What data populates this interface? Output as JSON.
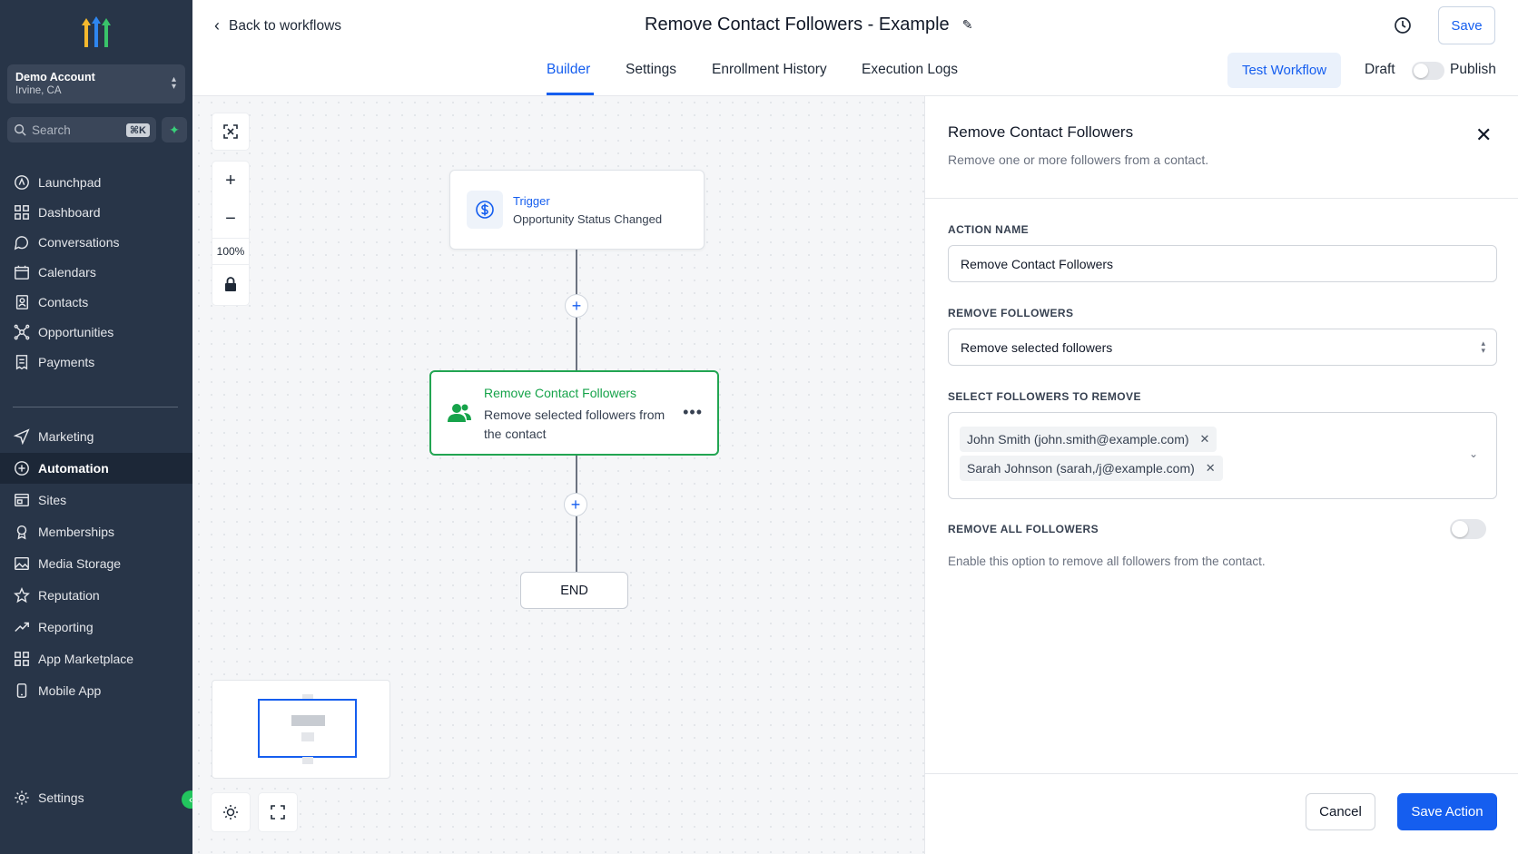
{
  "sidebar": {
    "account": {
      "name": "Demo Account",
      "location": "Irvine, CA"
    },
    "search": {
      "placeholder": "Search",
      "shortcut": "⌘K"
    },
    "items_top": [
      {
        "label": "Launchpad",
        "icon": "rocket-icon"
      },
      {
        "label": "Dashboard",
        "icon": "grid-icon"
      },
      {
        "label": "Conversations",
        "icon": "chat-icon"
      },
      {
        "label": "Calendars",
        "icon": "calendar-icon"
      },
      {
        "label": "Contacts",
        "icon": "contacts-icon"
      },
      {
        "label": "Opportunities",
        "icon": "network-icon"
      },
      {
        "label": "Payments",
        "icon": "receipt-icon"
      }
    ],
    "items_bottom": [
      {
        "label": "Marketing",
        "icon": "send-icon"
      },
      {
        "label": "Automation",
        "icon": "automation-icon",
        "active": true
      },
      {
        "label": "Sites",
        "icon": "sites-icon"
      },
      {
        "label": "Memberships",
        "icon": "badge-icon"
      },
      {
        "label": "Media Storage",
        "icon": "image-icon"
      },
      {
        "label": "Reputation",
        "icon": "star-icon"
      },
      {
        "label": "Reporting",
        "icon": "trend-icon"
      },
      {
        "label": "App Marketplace",
        "icon": "apps-icon"
      },
      {
        "label": "Mobile App",
        "icon": "phone-icon"
      }
    ],
    "settings_label": "Settings"
  },
  "header": {
    "back_label": "Back to workflows",
    "title": "Remove Contact Followers - Example",
    "save_label": "Save",
    "tabs": [
      "Builder",
      "Settings",
      "Enrollment History",
      "Execution Logs"
    ],
    "active_tab": "Builder",
    "test_label": "Test Workflow",
    "draft_label": "Draft",
    "publish_label": "Publish",
    "published": false
  },
  "canvas": {
    "zoom": "100%",
    "trigger": {
      "label": "Trigger",
      "name": "Opportunity Status Changed"
    },
    "action": {
      "label": "Remove Contact Followers",
      "description": "Remove selected followers from the contact"
    },
    "end_label": "END"
  },
  "panel": {
    "title": "Remove Contact Followers",
    "description": "Remove one or more followers from a contact.",
    "action_name_label": "ACTION NAME",
    "action_name_value": "Remove Contact Followers",
    "remove_followers_label": "REMOVE FOLLOWERS",
    "remove_followers_value": "Remove selected followers",
    "select_followers_label": "SELECT FOLLOWERS TO REMOVE",
    "selected_followers": [
      "John Smith (john.smith@example.com)",
      "Sarah Johnson (sarah,/j@example.com)"
    ],
    "remove_all_label": "REMOVE ALL FOLLOWERS",
    "remove_all_enabled": false,
    "remove_all_hint": "Enable this option to remove all followers from the contact.",
    "cancel_label": "Cancel",
    "save_action_label": "Save Action"
  },
  "colors": {
    "sidebar_bg": "#283548",
    "accent": "#155eef",
    "success": "#22a552"
  }
}
